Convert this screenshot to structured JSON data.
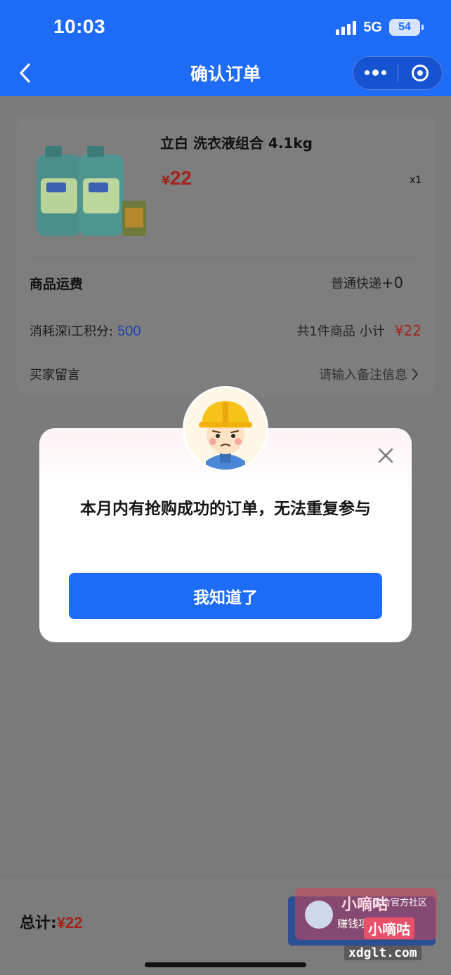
{
  "status_bar": {
    "time": "10:03",
    "network": "5G",
    "battery": "54"
  },
  "header": {
    "title": "确认订单",
    "bg_color": "#1e6bf5"
  },
  "order": {
    "product_name": "立白 洗衣液组合 4.1kg",
    "price_symbol": "¥",
    "price": "22",
    "quantity": "x1",
    "shipping_label": "商品运费",
    "shipping_method": "普通快递",
    "shipping_fee": "+0",
    "points_label": "消耗深i工积分:",
    "points_value": "500",
    "summary_count": "共1件商品",
    "summary_subtotal_label": "小计",
    "summary_subtotal": "¥22",
    "message_label": "买家留言",
    "message_placeholder": "请输入备注信息"
  },
  "modal": {
    "message": "本月内有抢购成功的订单，无法重复参与",
    "confirm_label": "我知道了"
  },
  "footer": {
    "total_label": "总计:",
    "total_amount": "¥22"
  },
  "watermark": {
    "title": "小嘀咕",
    "side_text": "综合官方社区",
    "sub_text": "赚钱项目交流",
    "badge": "小嘀咕",
    "url": "xdglt.com"
  }
}
